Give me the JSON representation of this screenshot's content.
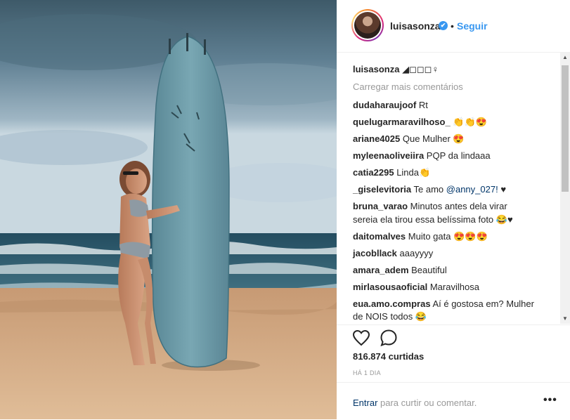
{
  "post": {
    "username": "luisasonza",
    "verified_badge": "✔",
    "separator": "•",
    "follow_label": "Seguir",
    "caption_text": "◢◻◻◻♀",
    "load_more": "Carregar mais comentários",
    "likes": "816.874 curtidas",
    "time": "HÁ 1 DIA"
  },
  "comments": [
    {
      "user": "dudaharaujoof",
      "text": "Rt"
    },
    {
      "user": "quelugarmaravilhoso_",
      "text": "👏👏😍"
    },
    {
      "user": "ariane4025",
      "text": "Que Mulher 😍"
    },
    {
      "user": "myleenaoliveiira",
      "text": "PQP da lindaaa"
    },
    {
      "user": "catia2295",
      "text": "Linda👏"
    },
    {
      "user": "_giselevitoria",
      "text": "Te amo",
      "mention": "@anny_027!",
      "after": "♥"
    },
    {
      "user": "bruna_varao",
      "text": "Minutos antes dela virar",
      "line2": "sereia ela tirou essa belíssima foto 😂♥"
    },
    {
      "user": "daitomalves",
      "text": "Muito gata 😍😍😍"
    },
    {
      "user": "jacobllack",
      "text": "aaayyyy"
    },
    {
      "user": "amara_adem",
      "text": "Beautiful"
    },
    {
      "user": "mirlasousaoficial",
      "text": "Maravilhosa"
    },
    {
      "user": "eua.amo.compras",
      "text": "Aí é gostosa em? Mulher",
      "line2": "de NOIS todos 😂"
    }
  ],
  "footer": {
    "login_link": "Entrar",
    "login_rest": " para curtir ou comentar.",
    "more": "•••"
  },
  "icons": {
    "heart": "heart-icon",
    "comment": "comment-icon",
    "verified": "verified-icon"
  },
  "colors": {
    "link_blue": "#3897f0",
    "mention_blue": "#003569",
    "muted": "#999999",
    "text": "#262626"
  }
}
